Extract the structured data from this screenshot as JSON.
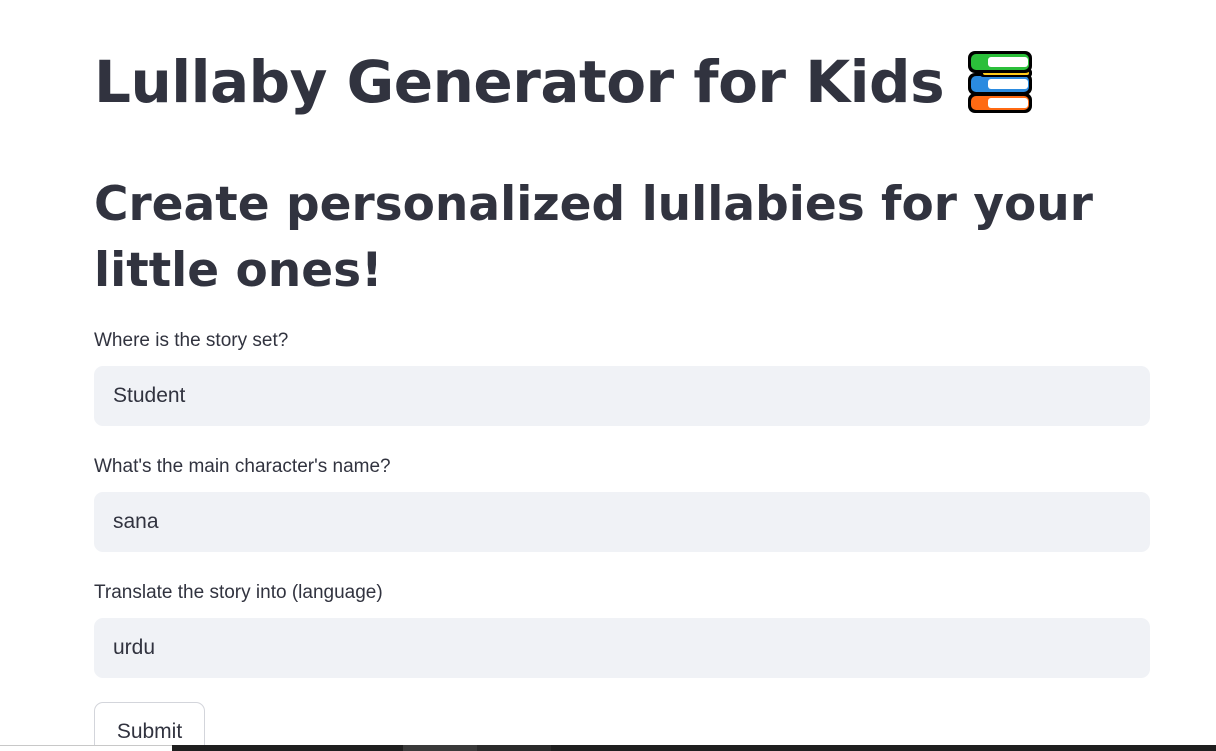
{
  "header": {
    "title": "Lullaby Generator for Kids",
    "title_icon": "books-icon"
  },
  "subheader": {
    "text": "Create personalized lullabies for your little ones!"
  },
  "form": {
    "fields": [
      {
        "label": "Where is the story set?",
        "value": "Student"
      },
      {
        "label": "What's the main character's name?",
        "value": "sana"
      },
      {
        "label": "Translate the story into (language)",
        "value": "urdu"
      }
    ],
    "submit_label": "Submit"
  },
  "colors": {
    "text": "#31333f",
    "input_bg": "#f0f2f6",
    "button_border": "#d3d5db",
    "background": "#ffffff"
  }
}
